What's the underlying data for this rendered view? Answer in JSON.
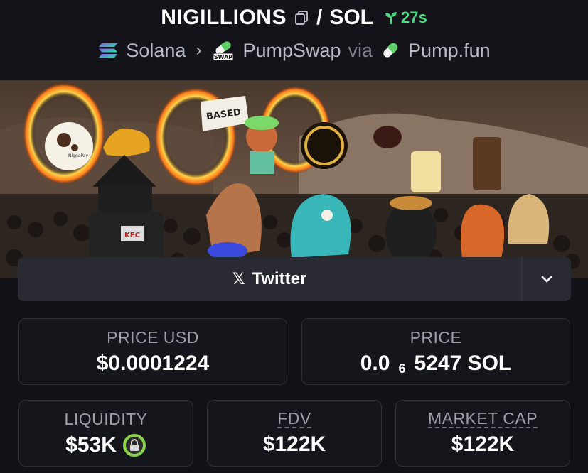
{
  "header": {
    "symbol": "NIGILLIONS",
    "separator": "/",
    "quote": "SOL",
    "age": "27s",
    "chain": "Solana",
    "dex": "PumpSwap",
    "via": "via",
    "launchpad": "Pump.fun",
    "swap_badge": "SWAP"
  },
  "banner": {
    "flag_text": "BASED",
    "logo_text": "NiggaPay",
    "kfc_text": "KFC"
  },
  "links": {
    "twitter_label": "Twitter"
  },
  "stats": {
    "price_usd_label": "PRICE USD",
    "price_usd": "$0.0001224",
    "price_label": "PRICE",
    "price_prefix": "0.0",
    "price_zeros": "6",
    "price_suffix": "5247 SOL",
    "liquidity_label": "LIQUIDITY",
    "liquidity": "$53K",
    "fdv_label": "FDV",
    "fdv": "$122K",
    "mcap_label": "MARKET CAP",
    "mcap": "$122K"
  },
  "colors": {
    "age_green": "#4dd780",
    "lock_green": "#8bd44a",
    "background": "#111118"
  }
}
